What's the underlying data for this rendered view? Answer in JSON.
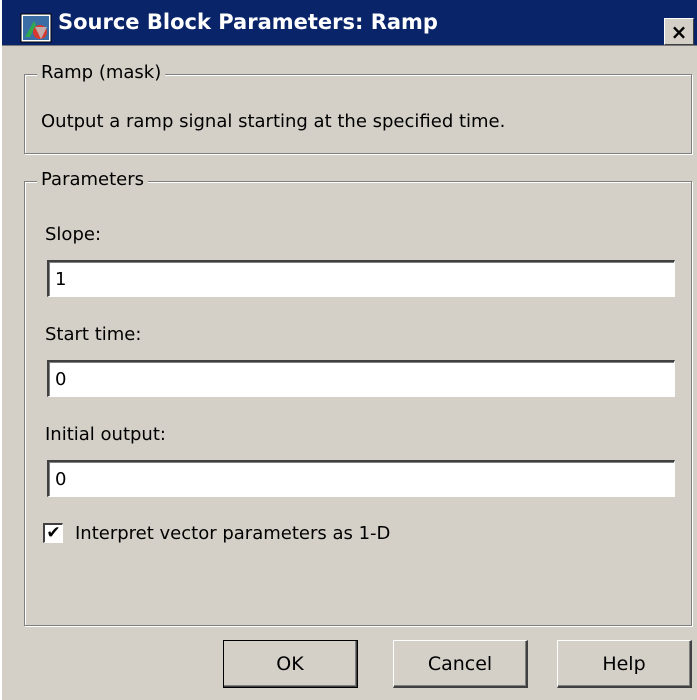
{
  "window": {
    "title": "Source Block Parameters: Ramp",
    "close_glyph": "×"
  },
  "mask_group": {
    "legend": "Ramp (mask)",
    "description": "Output a ramp signal starting at the specified time."
  },
  "parameters": {
    "legend": "Parameters",
    "slope": {
      "label": "Slope:",
      "value": "1"
    },
    "start_time": {
      "label": "Start time:",
      "value": "0"
    },
    "initial_output": {
      "label": "Initial output:",
      "value": "0"
    },
    "interpret_vector": {
      "label": "Interpret vector parameters as 1-D",
      "checked": true,
      "check_glyph": "✔"
    }
  },
  "buttons": {
    "ok": "OK",
    "cancel": "Cancel",
    "help": "Help"
  },
  "colors": {
    "titlebar": "#0a246a",
    "face": "#d4d0c8"
  },
  "icons": {
    "app": "simulink-block-icon",
    "close": "close-icon",
    "check": "checkmark-icon"
  }
}
